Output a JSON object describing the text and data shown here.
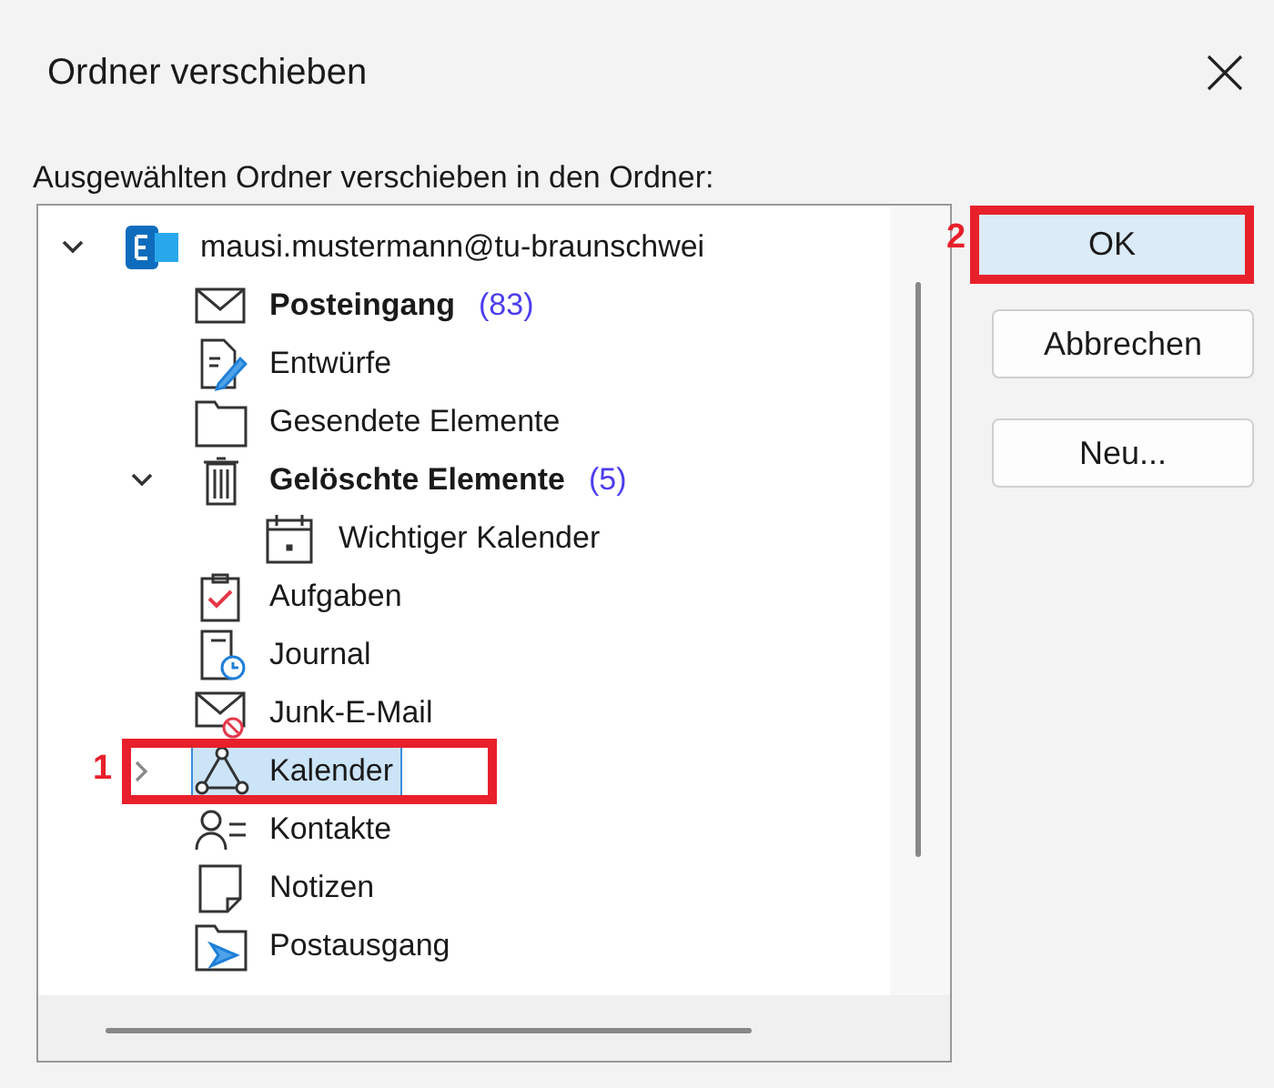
{
  "window": {
    "title": "Ordner verschieben"
  },
  "prompt": "Ausgewählten Ordner verschieben in den Ordner:",
  "tree": [
    {
      "name": "mausi.mustermann@tu-braunschwei",
      "kind": "account",
      "bold": false,
      "selected": false,
      "expanded": true,
      "children": [
        {
          "name": "Posteingang",
          "kind": "inbox",
          "bold": true,
          "selected": false,
          "count": "(83)"
        },
        {
          "name": "Entwürfe",
          "kind": "drafts",
          "bold": false,
          "selected": false
        },
        {
          "name": "Gesendete Elemente",
          "kind": "folder",
          "bold": false,
          "selected": false
        },
        {
          "name": "Gelöschte Elemente",
          "kind": "trash",
          "bold": true,
          "selected": false,
          "count": "(5)",
          "expanded": true,
          "children": [
            {
              "name": "Wichtiger Kalender",
              "kind": "calendar",
              "bold": false,
              "selected": false
            }
          ]
        },
        {
          "name": "Aufgaben",
          "kind": "tasks",
          "bold": false,
          "selected": false
        },
        {
          "name": "Journal",
          "kind": "journal",
          "bold": false,
          "selected": false
        },
        {
          "name": "Junk-E-Mail",
          "kind": "junk",
          "bold": false,
          "selected": false
        },
        {
          "name": "Kalender",
          "kind": "group",
          "bold": false,
          "expanded": false,
          "selected": true,
          "annotation": "1"
        },
        {
          "name": "Kontakte",
          "kind": "contacts",
          "bold": false,
          "selected": false
        },
        {
          "name": "Notizen",
          "kind": "notes",
          "bold": false,
          "selected": false
        },
        {
          "name": "Postausgang",
          "kind": "outbox",
          "bold": false,
          "selected": false
        }
      ]
    }
  ],
  "buttons": [
    {
      "label": "OK",
      "default": true,
      "annotation": "2"
    },
    {
      "label": "Abbrechen",
      "default": false
    },
    {
      "label": "Neu...",
      "default": false
    }
  ]
}
